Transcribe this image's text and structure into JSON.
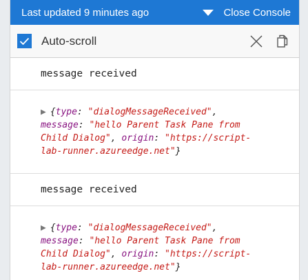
{
  "header": {
    "status": "Last updated 9 minutes ago",
    "close_label": "Close Console"
  },
  "toolbar": {
    "autoscroll_label": "Auto-scroll",
    "autoscroll_checked": true
  },
  "icons": {
    "checkbox": "checkmark-icon",
    "clear": "close-icon",
    "copy": "copy-icon",
    "expand": "triangle-right-icon",
    "collapse": "triangle-down-icon"
  },
  "colors": {
    "accent": "#1e78d4",
    "key": "#881280",
    "string": "#c41a16"
  },
  "entries": [
    {
      "type": "text",
      "text": "message received"
    },
    {
      "type": "object",
      "expander": "▶",
      "open": "{",
      "key1": "type",
      "val1": "\"dialogMessageReceived\"",
      "key2": "message",
      "val2a": "\"hello Parent Task Pane from",
      "val2b": "Child Dialog\"",
      "key3": "origin",
      "val3a": "\"https://script-",
      "val3b": "lab-runner.azureedge.net\"",
      "close": "}"
    },
    {
      "type": "text",
      "text": "message received"
    },
    {
      "type": "object",
      "expander": "▶",
      "open": "{",
      "key1": "type",
      "val1": "\"dialogMessageReceived\"",
      "key2": "message",
      "val2a": "\"hello Parent Task Pane from",
      "val2b": "Child Dialog\"",
      "key3": "origin",
      "val3a": "\"https://script-",
      "val3b": "lab-runner.azureedge.net\"",
      "close": "}"
    }
  ]
}
